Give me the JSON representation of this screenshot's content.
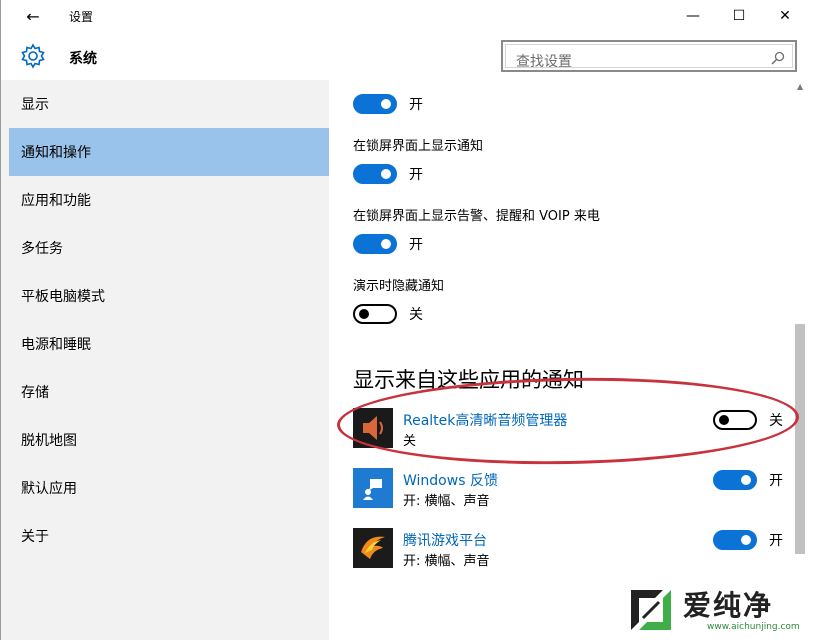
{
  "titlebar": {
    "back_glyph": "←",
    "title": "设置",
    "min_glyph": "—",
    "max_glyph": "☐",
    "close_glyph": "✕"
  },
  "header": {
    "title": "系统",
    "search_placeholder": "查找设置",
    "icon": "gear-icon"
  },
  "sidebar": {
    "items": [
      {
        "label": "显示",
        "active": false
      },
      {
        "label": "通知和操作",
        "active": true
      },
      {
        "label": "应用和功能",
        "active": false
      },
      {
        "label": "多任务",
        "active": false
      },
      {
        "label": "平板电脑模式",
        "active": false
      },
      {
        "label": "电源和睡眠",
        "active": false
      },
      {
        "label": "存储",
        "active": false
      },
      {
        "label": "脱机地图",
        "active": false
      },
      {
        "label": "默认应用",
        "active": false
      },
      {
        "label": "关于",
        "active": false
      }
    ]
  },
  "settings": [
    {
      "label": "",
      "state": "开",
      "on": true
    },
    {
      "label": "在锁屏界面上显示通知",
      "state": "开",
      "on": true
    },
    {
      "label": "在锁屏界面上显示告警、提醒和 VOIP 来电",
      "state": "开",
      "on": true
    },
    {
      "label": "演示时隐藏通知",
      "state": "关",
      "on": false
    }
  ],
  "apps_section": {
    "title": "显示来自这些应用的通知",
    "apps": [
      {
        "name": "Realtek高清晰音频管理器",
        "sub": "关",
        "state": "关",
        "on": false,
        "icon": "speaker-icon"
      },
      {
        "name": "Windows 反馈",
        "sub": "开: 横幅、声音",
        "state": "开",
        "on": true,
        "icon": "feedback-icon"
      },
      {
        "name": "腾讯游戏平台",
        "sub": "开: 横幅、声音",
        "state": "开",
        "on": true,
        "icon": "tencent-games-icon"
      }
    ]
  },
  "watermark": {
    "text": "爱纯净",
    "url": "www.aichunjing.com"
  },
  "colors": {
    "accent": "#0b72d6",
    "selected_nav": "#99c3ea",
    "link": "#0067b8",
    "highlight_circle": "#c8323c"
  }
}
